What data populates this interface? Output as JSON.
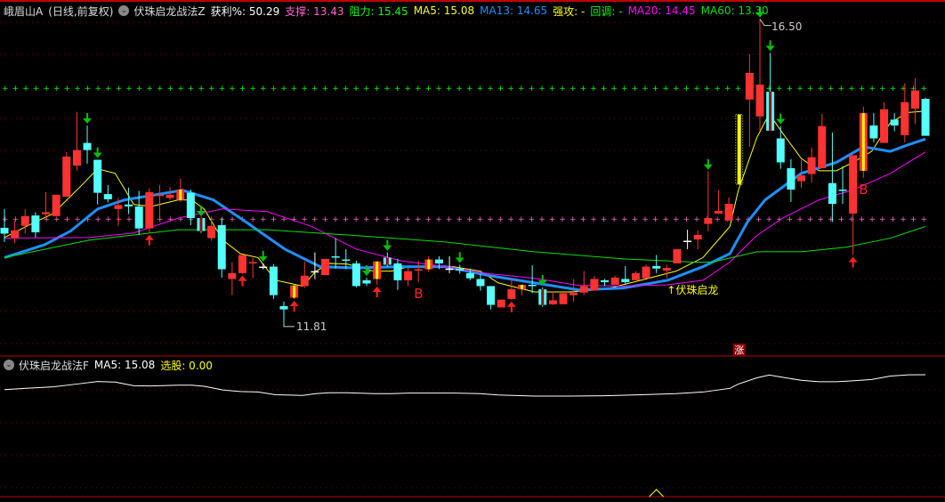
{
  "header": {
    "stock": "峨眉山A",
    "period": "(日线,前复权)",
    "indicator": "伏珠启龙战法Z",
    "profit_label": "获利%: 50.29",
    "support_label": "支撑: 13.43",
    "resist_label": "阻力: 15.45",
    "ma5_label": "MA5: 15.08",
    "ma13_label": "MA13: 14.65",
    "strong_label": "强攻: -",
    "pullback_label": "回调: -",
    "ma20_label": "MA20: 14.45",
    "ma60_label": "MA60: 13.30"
  },
  "sub_header": {
    "indicator": "伏珠启龙战法F",
    "ma5_label": "MA5: 15.08",
    "select_label": "选股: 0.00"
  },
  "annotations": {
    "high_label": "16.50",
    "low_label": "11.81",
    "signal_text": "↑伏珠启龙",
    "b_label": "B",
    "limit_badge": "涨"
  },
  "colors": {
    "up": "#ff3232",
    "down": "#54ffff",
    "ma5": "#ffff00",
    "ma13": "#1e90ff",
    "ma20": "#ff00ff",
    "ma60": "#00e000",
    "grid": "#8b0000",
    "support": "#ff66cc",
    "resist": "#00ff00"
  },
  "chart_data": {
    "type": "candlestick",
    "title": "峨眉山A 日线 前复权",
    "ylim": [
      11.6,
      16.8
    ],
    "support": 13.43,
    "resistance": 15.45,
    "high": {
      "index": 73,
      "value": 16.5
    },
    "low": {
      "index": 27,
      "value": 11.81
    },
    "candles": [
      [
        13.28,
        13.57,
        13.06,
        13.19,
        "d"
      ],
      [
        13.12,
        13.39,
        13.04,
        13.24,
        "u"
      ],
      [
        13.31,
        13.57,
        13.19,
        13.46,
        "u"
      ],
      [
        13.47,
        13.52,
        13.13,
        13.21,
        "d"
      ],
      [
        13.49,
        13.83,
        13.43,
        13.52,
        "u"
      ],
      [
        13.46,
        13.79,
        13.46,
        13.79,
        "u"
      ],
      [
        13.76,
        14.45,
        13.76,
        14.38,
        "u"
      ],
      [
        14.24,
        15.07,
        14.16,
        14.48,
        "u"
      ],
      [
        14.59,
        14.86,
        14.27,
        14.48,
        "d"
      ],
      [
        14.33,
        14.33,
        13.64,
        13.82,
        "d"
      ],
      [
        13.8,
        13.94,
        13.67,
        13.72,
        "d"
      ],
      [
        13.57,
        13.74,
        13.31,
        13.63,
        "u"
      ],
      [
        13.64,
        13.9,
        13.49,
        13.61,
        "d"
      ],
      [
        13.61,
        13.85,
        13.17,
        13.27,
        "d"
      ],
      [
        13.27,
        13.89,
        13.2,
        13.83,
        "u"
      ],
      [
        13.78,
        13.94,
        13.37,
        13.79,
        "u"
      ],
      [
        13.74,
        13.91,
        13.71,
        13.79,
        "u"
      ],
      [
        13.71,
        14.04,
        13.68,
        13.87,
        "uy"
      ],
      [
        13.82,
        13.87,
        13.32,
        13.43,
        "d"
      ],
      [
        13.43,
        13.43,
        13.2,
        13.23,
        "dr"
      ],
      [
        13.12,
        13.43,
        13.08,
        13.31,
        "u"
      ],
      [
        13.32,
        13.43,
        12.51,
        12.64,
        "d"
      ],
      [
        12.49,
        12.75,
        12.24,
        12.58,
        "u"
      ],
      [
        12.58,
        12.86,
        12.57,
        12.86,
        "u"
      ],
      [
        12.73,
        12.82,
        12.5,
        12.75,
        "u"
      ],
      [
        12.68,
        12.73,
        12.64,
        12.68,
        "w"
      ],
      [
        12.68,
        12.72,
        12.18,
        12.24,
        "d"
      ],
      [
        12.07,
        12.14,
        11.81,
        12.02,
        "d"
      ],
      [
        12.2,
        12.39,
        12.18,
        12.39,
        "uy"
      ],
      [
        12.38,
        12.76,
        12.35,
        12.54,
        "u"
      ],
      [
        12.61,
        12.9,
        12.49,
        12.61,
        "w"
      ],
      [
        12.55,
        12.8,
        12.55,
        12.8,
        "u"
      ],
      [
        12.84,
        13.12,
        12.65,
        12.84,
        "c"
      ],
      [
        12.79,
        12.95,
        12.64,
        12.79,
        "c"
      ],
      [
        12.73,
        12.77,
        12.36,
        12.38,
        "d"
      ],
      [
        12.47,
        12.51,
        12.38,
        12.42,
        "d"
      ],
      [
        12.49,
        12.76,
        12.4,
        12.76,
        "uy"
      ],
      [
        12.82,
        12.9,
        12.68,
        12.71,
        "dr"
      ],
      [
        12.73,
        12.8,
        12.32,
        12.47,
        "d"
      ],
      [
        12.47,
        12.66,
        12.38,
        12.61,
        "u"
      ],
      [
        12.62,
        12.77,
        12.44,
        12.64,
        "u"
      ],
      [
        12.64,
        12.84,
        12.6,
        12.79,
        "uy"
      ],
      [
        12.79,
        12.84,
        12.64,
        12.73,
        "d"
      ],
      [
        12.65,
        12.84,
        12.58,
        12.65,
        "w"
      ],
      [
        12.65,
        12.71,
        12.57,
        12.62,
        "d"
      ],
      [
        12.58,
        12.65,
        12.47,
        12.5,
        "d"
      ],
      [
        12.49,
        12.57,
        12.31,
        12.38,
        "d"
      ],
      [
        12.38,
        12.38,
        12.02,
        12.09,
        "d"
      ],
      [
        12.05,
        12.17,
        12.05,
        12.17,
        "u"
      ],
      [
        12.18,
        12.5,
        12.17,
        12.33,
        "u"
      ],
      [
        12.33,
        12.4,
        12.24,
        12.4,
        "uy"
      ],
      [
        12.4,
        12.7,
        12.27,
        12.4,
        "c"
      ],
      [
        12.33,
        12.36,
        12.06,
        12.09,
        "dr"
      ],
      [
        12.1,
        12.29,
        12.09,
        12.16,
        "u"
      ],
      [
        12.1,
        12.27,
        12.1,
        12.27,
        "u"
      ],
      [
        12.24,
        12.49,
        12.14,
        12.28,
        "u"
      ],
      [
        12.28,
        12.61,
        12.24,
        12.38,
        "u"
      ],
      [
        12.31,
        12.54,
        12.31,
        12.49,
        "u"
      ],
      [
        12.47,
        12.49,
        12.38,
        12.44,
        "d"
      ],
      [
        12.4,
        12.54,
        12.4,
        12.51,
        "u"
      ],
      [
        12.49,
        12.69,
        12.4,
        12.44,
        "d"
      ],
      [
        12.47,
        12.61,
        12.47,
        12.58,
        "u"
      ],
      [
        12.5,
        12.71,
        12.5,
        12.68,
        "u"
      ],
      [
        12.69,
        12.86,
        12.58,
        12.65,
        "d"
      ],
      [
        12.62,
        12.71,
        12.5,
        12.66,
        "u"
      ],
      [
        12.73,
        12.95,
        12.73,
        12.95,
        "u"
      ],
      [
        13.08,
        13.25,
        12.95,
        13.08,
        "w"
      ],
      [
        13.1,
        13.24,
        12.95,
        13.17,
        "u"
      ],
      [
        13.34,
        14.15,
        13.23,
        13.43,
        "u"
      ],
      [
        13.5,
        13.86,
        13.49,
        13.54,
        "u"
      ],
      [
        13.39,
        13.75,
        13.39,
        13.65,
        "u"
      ],
      [
        13.95,
        15.03,
        13.95,
        15.03,
        "y"
      ],
      [
        15.26,
        15.96,
        14.53,
        15.67,
        "u"
      ],
      [
        15.0,
        16.5,
        14.78,
        15.49,
        "u"
      ],
      [
        15.38,
        15.98,
        14.78,
        14.78,
        "dr"
      ],
      [
        14.66,
        14.85,
        14.19,
        14.29,
        "d"
      ],
      [
        14.2,
        14.34,
        13.68,
        13.87,
        "d"
      ],
      [
        14.0,
        14.33,
        13.9,
        14.09,
        "u"
      ],
      [
        14.11,
        14.52,
        13.98,
        14.37,
        "u"
      ],
      [
        14.2,
        15.04,
        14.2,
        14.85,
        "u"
      ],
      [
        13.97,
        14.75,
        13.37,
        13.65,
        "d"
      ],
      [
        13.87,
        14.23,
        13.65,
        13.87,
        "c"
      ],
      [
        13.5,
        14.4,
        12.86,
        14.4,
        "u"
      ],
      [
        14.16,
        15.15,
        14.05,
        15.05,
        "uy"
      ],
      [
        14.86,
        15.05,
        14.6,
        14.66,
        "d"
      ],
      [
        14.59,
        15.22,
        14.59,
        15.11,
        "u"
      ],
      [
        14.95,
        15.05,
        14.77,
        14.86,
        "d"
      ],
      [
        14.71,
        15.51,
        14.6,
        15.22,
        "u"
      ],
      [
        15.12,
        15.59,
        14.88,
        15.4,
        "u"
      ],
      [
        15.27,
        15.29,
        14.7,
        14.7,
        "d"
      ]
    ],
    "series": [
      {
        "name": "MA5",
        "points": [
          [
            0,
            13.13
          ],
          [
            2.1,
            13.3
          ],
          [
            4.7,
            13.5
          ],
          [
            7.3,
            13.91
          ],
          [
            9.0,
            14.19
          ],
          [
            10.7,
            14.12
          ],
          [
            12.5,
            13.64
          ],
          [
            14.2,
            13.61
          ],
          [
            16.8,
            13.71
          ],
          [
            18.1,
            13.71
          ],
          [
            19.3,
            13.57
          ],
          [
            21.1,
            13.09
          ],
          [
            22.8,
            12.88
          ],
          [
            24.5,
            12.82
          ],
          [
            26.2,
            12.47
          ],
          [
            28.8,
            12.38
          ],
          [
            30.1,
            12.61
          ],
          [
            31.4,
            12.73
          ],
          [
            33.1,
            12.72
          ],
          [
            35.7,
            12.61
          ],
          [
            37.4,
            12.61
          ],
          [
            39.1,
            12.68
          ],
          [
            41.7,
            12.68
          ],
          [
            43.4,
            12.68
          ],
          [
            46.0,
            12.61
          ],
          [
            47.7,
            12.43
          ],
          [
            51.2,
            12.29
          ],
          [
            54.6,
            12.29
          ],
          [
            58.0,
            12.33
          ],
          [
            61.5,
            12.47
          ],
          [
            64.9,
            12.61
          ],
          [
            67.5,
            12.82
          ],
          [
            70.1,
            13.3
          ],
          [
            70.9,
            13.85
          ],
          [
            72.7,
            14.67
          ],
          [
            73.9,
            15.04
          ],
          [
            75.2,
            14.74
          ],
          [
            77.0,
            14.35
          ],
          [
            78.7,
            14.16
          ],
          [
            80.4,
            14.16
          ],
          [
            82.1,
            14.3
          ],
          [
            83.8,
            14.46
          ],
          [
            85.6,
            14.9
          ],
          [
            87.3,
            15.06
          ],
          [
            89.0,
            15.08
          ]
        ]
      },
      {
        "name": "MA13",
        "points": [
          [
            0,
            12.82
          ],
          [
            3.9,
            13.02
          ],
          [
            6.4,
            13.23
          ],
          [
            9.0,
            13.57
          ],
          [
            11.6,
            13.71
          ],
          [
            15.0,
            13.8
          ],
          [
            17.2,
            13.86
          ],
          [
            20.2,
            13.71
          ],
          [
            23.6,
            13.34
          ],
          [
            27.1,
            12.95
          ],
          [
            30.5,
            12.68
          ],
          [
            34.0,
            12.66
          ],
          [
            38.3,
            12.68
          ],
          [
            42.6,
            12.68
          ],
          [
            46.9,
            12.54
          ],
          [
            51.2,
            12.43
          ],
          [
            55.5,
            12.32
          ],
          [
            59.8,
            12.35
          ],
          [
            64.1,
            12.47
          ],
          [
            67.5,
            12.68
          ],
          [
            70.1,
            12.88
          ],
          [
            71.8,
            13.37
          ],
          [
            73.5,
            13.71
          ],
          [
            77.0,
            14.12
          ],
          [
            80.4,
            14.29
          ],
          [
            83.0,
            14.53
          ],
          [
            85.6,
            14.46
          ],
          [
            87.3,
            14.56
          ],
          [
            89.0,
            14.65
          ]
        ]
      },
      {
        "name": "MA20",
        "points": [
          [
            0,
            13.12
          ],
          [
            8.2,
            13.13
          ],
          [
            12.5,
            13.2
          ],
          [
            16.8,
            13.43
          ],
          [
            21.1,
            13.57
          ],
          [
            25.4,
            13.53
          ],
          [
            29.7,
            13.3
          ],
          [
            34.0,
            12.95
          ],
          [
            38.3,
            12.77
          ],
          [
            42.6,
            12.68
          ],
          [
            46.9,
            12.57
          ],
          [
            51.2,
            12.5
          ],
          [
            55.5,
            12.39
          ],
          [
            59.8,
            12.38
          ],
          [
            64.1,
            12.4
          ],
          [
            67.5,
            12.47
          ],
          [
            70.1,
            12.75
          ],
          [
            72.7,
            13.16
          ],
          [
            75.2,
            13.43
          ],
          [
            78.7,
            13.71
          ],
          [
            82.1,
            13.87
          ],
          [
            85.6,
            14.12
          ],
          [
            89.0,
            14.45
          ]
        ]
      },
      {
        "name": "MA60",
        "points": [
          [
            0,
            12.82
          ],
          [
            8.2,
            13.09
          ],
          [
            16.8,
            13.25
          ],
          [
            25.4,
            13.25
          ],
          [
            34.0,
            13.16
          ],
          [
            42.6,
            13.06
          ],
          [
            51.2,
            12.91
          ],
          [
            59.8,
            12.8
          ],
          [
            66.6,
            12.75
          ],
          [
            68.4,
            12.75
          ],
          [
            72.7,
            12.91
          ],
          [
            77.0,
            12.91
          ],
          [
            81.3,
            12.98
          ],
          [
            85.6,
            13.12
          ],
          [
            89.0,
            13.3
          ]
        ]
      }
    ],
    "sell_arrows": [
      8,
      9,
      19,
      25,
      35,
      37,
      44,
      52,
      68,
      73,
      74,
      75
    ],
    "buy_arrows": [
      14,
      23,
      28,
      36,
      49,
      82
    ],
    "b_marks": [
      40,
      83
    ],
    "signal_text_index": 64,
    "limit_badge_index": 71,
    "sub_signal_index": 63
  }
}
